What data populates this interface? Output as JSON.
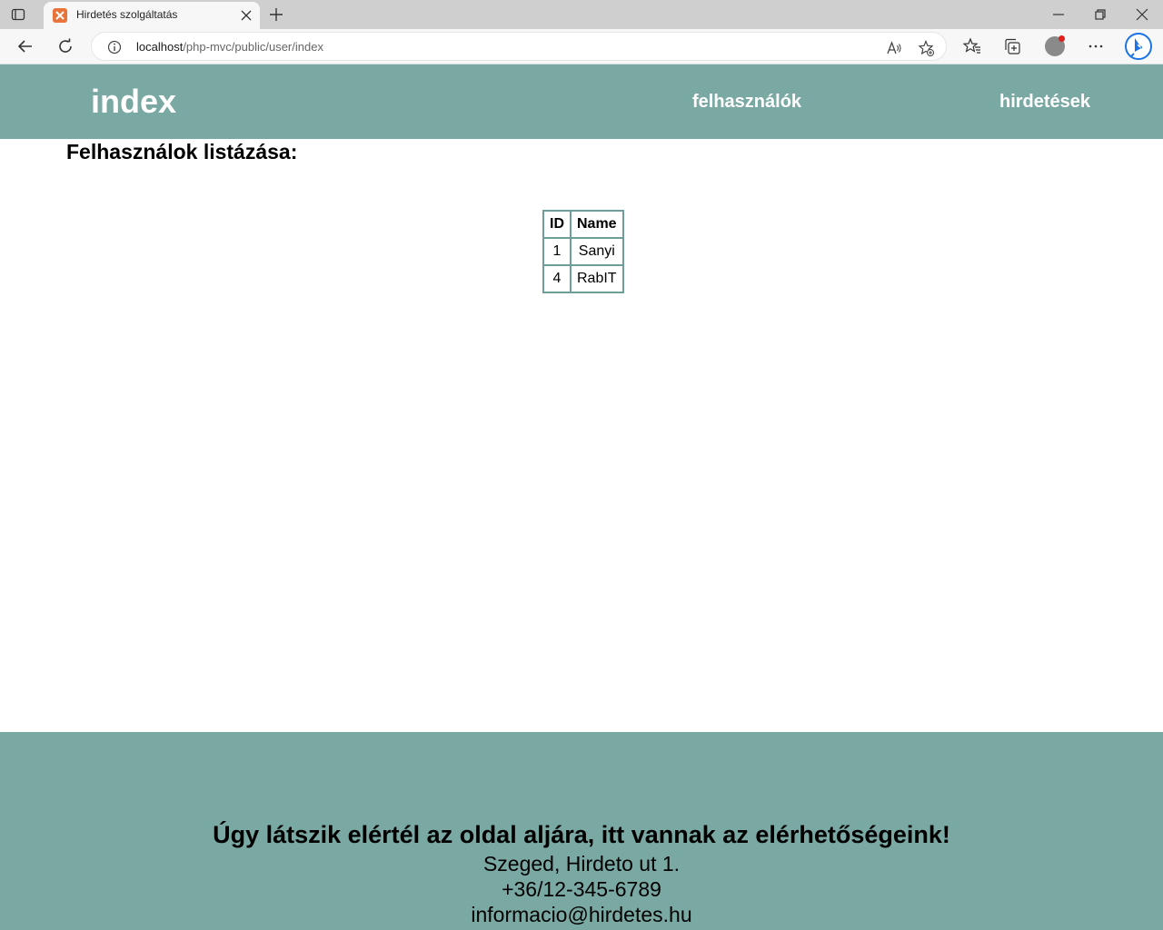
{
  "browser": {
    "tab_title": "Hirdetés szolgáltatás",
    "url_host": "localhost",
    "url_path": "/php-mvc/public/user/index"
  },
  "header": {
    "logo": "index",
    "nav": [
      "felhasználók",
      "hirdetések"
    ]
  },
  "main": {
    "heading": "Felhasználok listázása:",
    "table": {
      "headers": [
        "ID",
        "Name"
      ],
      "rows": [
        [
          "1",
          "Sanyi"
        ],
        [
          "4",
          "RabIT"
        ]
      ]
    }
  },
  "footer": {
    "title": "Úgy látszik elértél az oldal aljára, itt vannak az elérhetőségeink!",
    "address": "Szeged, Hirdeto ut 1.",
    "phone": "+36/12-345-6789",
    "email": "informacio@hirdetes.hu"
  },
  "colors": {
    "header_bg": "#7aa9a4",
    "table_border": "#6e9e99"
  }
}
